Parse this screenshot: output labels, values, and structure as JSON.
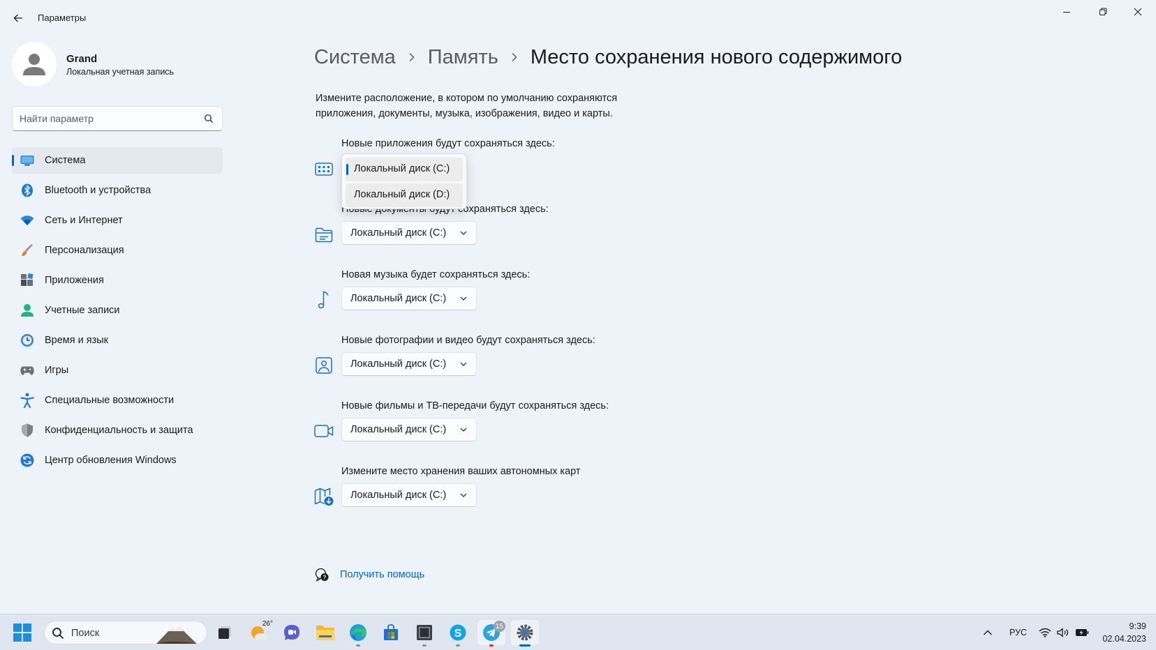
{
  "window": {
    "title": "Параметры"
  },
  "profile": {
    "name": "Grand",
    "account_type": "Локальная учетная запись"
  },
  "search": {
    "placeholder": "Найти параметр"
  },
  "nav": {
    "items": [
      {
        "label": "Система",
        "icon": "system-icon",
        "active": true
      },
      {
        "label": "Bluetooth и устройства",
        "icon": "bluetooth-icon"
      },
      {
        "label": "Сеть и Интернет",
        "icon": "wifi-icon"
      },
      {
        "label": "Персонализация",
        "icon": "brush-icon"
      },
      {
        "label": "Приложения",
        "icon": "apps-icon"
      },
      {
        "label": "Учетные записи",
        "icon": "account-icon"
      },
      {
        "label": "Время и язык",
        "icon": "clock-globe-icon"
      },
      {
        "label": "Игры",
        "icon": "gamepad-icon"
      },
      {
        "label": "Специальные возможности",
        "icon": "accessibility-icon"
      },
      {
        "label": "Конфиденциальность и защита",
        "icon": "shield-icon"
      },
      {
        "label": "Центр обновления Windows",
        "icon": "update-icon"
      }
    ]
  },
  "breadcrumb": {
    "items": [
      "Система",
      "Память",
      "Место сохранения нового содержимого"
    ]
  },
  "description": "Измените расположение, в котором по умолчанию сохраняются приложения, документы, музыка, изображения, видео и карты.",
  "settings": [
    {
      "label": "Новые приложения будут сохраняться здесь:",
      "value": "Локальный диск (C:)",
      "icon": "apps-storage-icon",
      "expanded": true
    },
    {
      "label": "Новые документы будут сохраняться здесь:",
      "value": "Локальный диск (C:)",
      "icon": "documents-folder-icon"
    },
    {
      "label": "Новая музыка будет сохраняться здесь:",
      "value": "Локальный диск (C:)",
      "icon": "music-note-icon"
    },
    {
      "label": "Новые фотографии и видео будут сохраняться здесь:",
      "value": "Локальный диск (C:)",
      "icon": "photo-icon"
    },
    {
      "label": "Новые фильмы и ТВ-передачи будут сохраняться здесь:",
      "value": "Локальный диск (C:)",
      "icon": "video-camera-icon"
    },
    {
      "label": "Измените место хранения ваших автономных карт",
      "value": "Локальный диск (C:)",
      "icon": "map-download-icon"
    }
  ],
  "popup": {
    "options": [
      "Локальный диск (C:)",
      "Локальный диск (D:)"
    ],
    "selected": "Локальный диск (C:)"
  },
  "help": {
    "label": "Получить помощь"
  },
  "taskbar": {
    "search_label": "Поиск",
    "weather_temp": "26°",
    "telegram_badge": "15",
    "language": "РУС",
    "time": "9:39",
    "date": "02.04.2023"
  },
  "colors": {
    "accent": "#0067c0",
    "background": "#eef3f9",
    "taskbar": "#dfe6ef"
  }
}
